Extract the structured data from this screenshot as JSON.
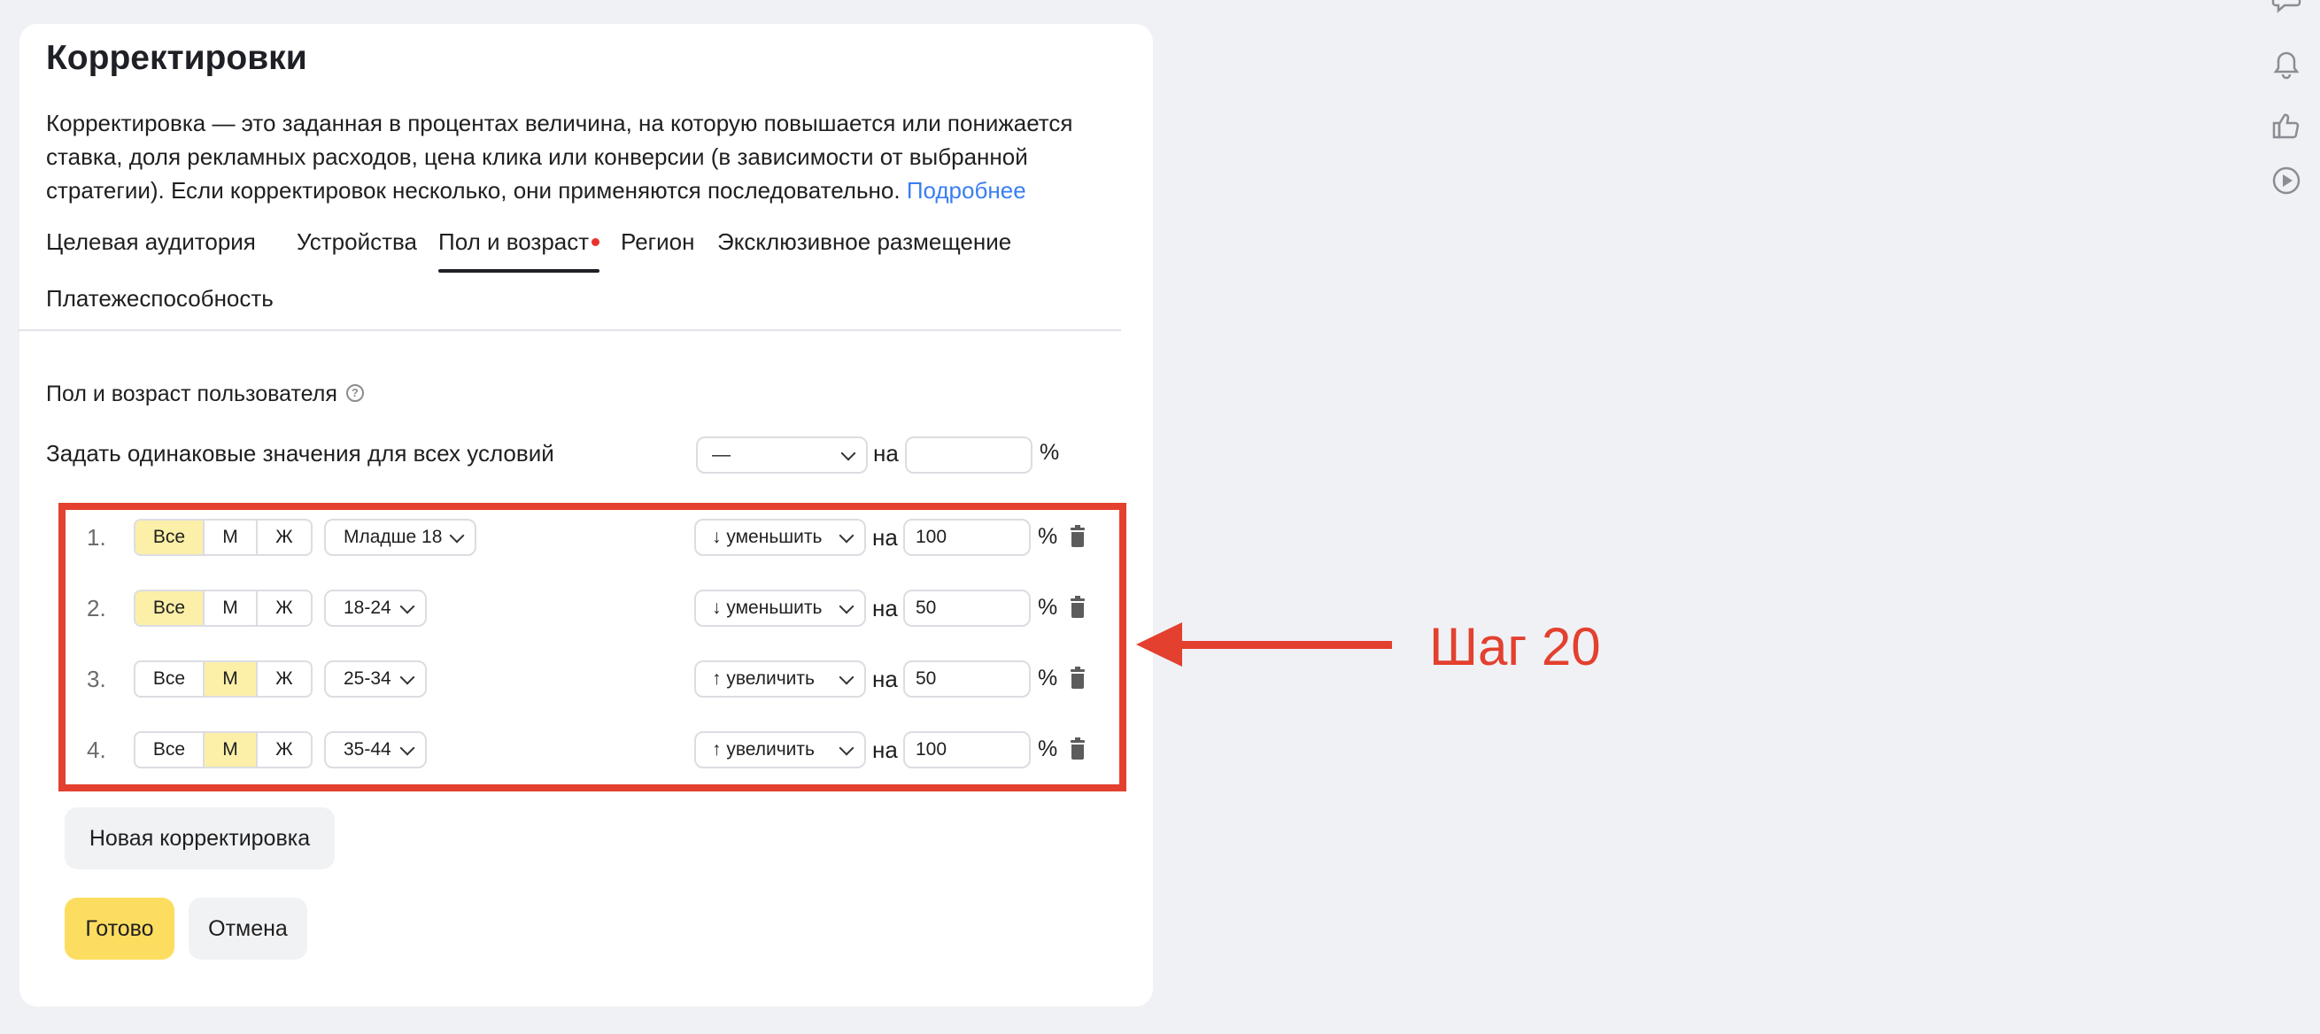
{
  "dialog": {
    "title": "Корректировки",
    "description": "Корректировка — это заданная в процентах величина, на которую повышается или понижается ставка, доля рекламных расходов, цена клика или конверсии (в зависимости от выбранной стратегии). Если корректировок несколько, они применяются последовательно.",
    "more_link": "Подробнее"
  },
  "tabs": [
    {
      "label": "Целевая аудитория",
      "active": false
    },
    {
      "label": "Устройства",
      "active": false
    },
    {
      "label": "Пол и возраст",
      "active": true,
      "has_dot": true
    },
    {
      "label": "Регион",
      "active": false
    },
    {
      "label": "Эксклюзивное размещение",
      "active": false
    },
    {
      "label": "Платежеспособность",
      "active": false
    }
  ],
  "section_label": "Пол и возраст пользователя",
  "help_icon": "?",
  "same_values": {
    "label": "Задать одинаковые значения для всех условий",
    "select_value": "—",
    "na": "на",
    "value": "",
    "percent": "%"
  },
  "gender_options": [
    "Все",
    "М",
    "Ж"
  ],
  "rows": [
    {
      "num": "1.",
      "gender": "Все",
      "age": "Младше 18",
      "action": "↓ уменьшить",
      "na": "на",
      "value": "100",
      "percent": "%"
    },
    {
      "num": "2.",
      "gender": "Все",
      "age": "18-24",
      "action": "↓ уменьшить",
      "na": "на",
      "value": "50",
      "percent": "%"
    },
    {
      "num": "3.",
      "gender": "М",
      "age": "25-34",
      "action": "↑ увеличить",
      "na": "на",
      "value": "50",
      "percent": "%"
    },
    {
      "num": "4.",
      "gender": "М",
      "age": "35-44",
      "action": "↑ увеличить",
      "na": "на",
      "value": "100",
      "percent": "%"
    }
  ],
  "buttons": {
    "new_adjustment": "Новая корректировка",
    "done": "Готово",
    "cancel": "Отмена"
  },
  "annotation": {
    "step_label": "Шаг 20",
    "color": "#e3402f"
  },
  "side_icons": [
    "chat-icon",
    "bell-icon",
    "thumbs-up-icon",
    "play-icon"
  ]
}
